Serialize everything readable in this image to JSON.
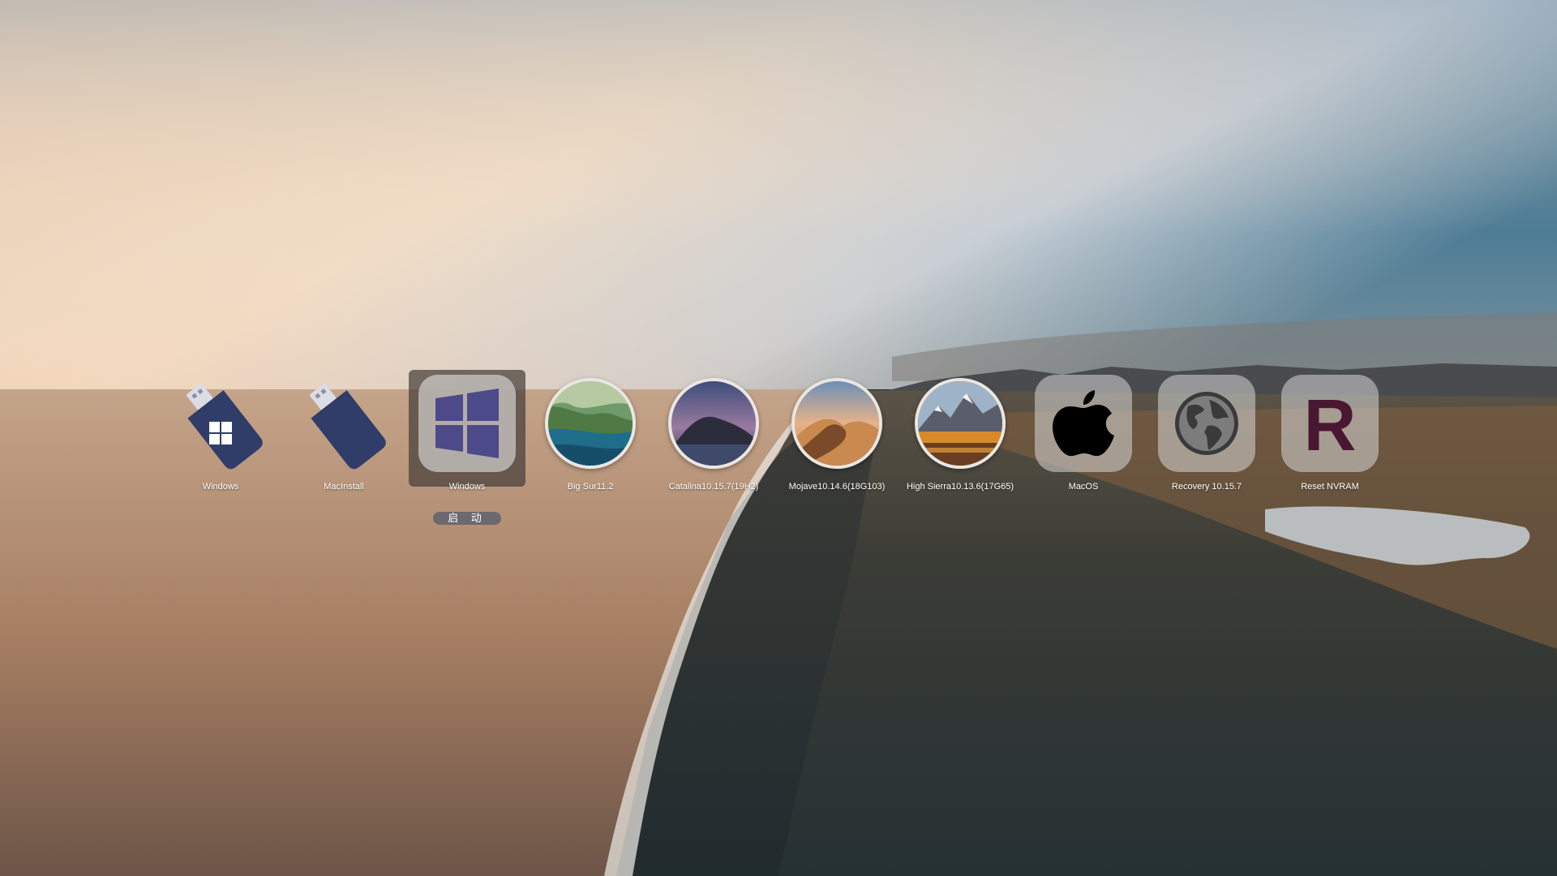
{
  "boot_entries": [
    {
      "label": "Windows",
      "icon": "usb-windows-icon"
    },
    {
      "label": "MacInstall",
      "icon": "usb-drive-icon"
    },
    {
      "label": "Windows",
      "icon": "windows-logo-icon",
      "selected": true
    },
    {
      "label": "Big Sur11.2",
      "icon": "big-sur-disk-icon"
    },
    {
      "label": "Catalina10.15.7(19H2)",
      "icon": "catalina-disk-icon"
    },
    {
      "label": "Mojave10.14.6(18G103)",
      "icon": "mojave-disk-icon"
    },
    {
      "label": "High Sierra10.13.6(17G65)",
      "icon": "high-sierra-disk-icon"
    },
    {
      "label": "MacOS",
      "icon": "apple-logo-icon"
    },
    {
      "label": "Recovery 10.15.7",
      "icon": "recovery-globe-icon"
    },
    {
      "label": "Reset NVRAM",
      "icon": "reset-nvram-r-icon"
    }
  ],
  "boot_button": {
    "label": "启 动"
  },
  "colors": {
    "usb_blue": "#2f3d68",
    "windows_purple": "#4d4a8a",
    "nvram_r": "#4a1733"
  }
}
